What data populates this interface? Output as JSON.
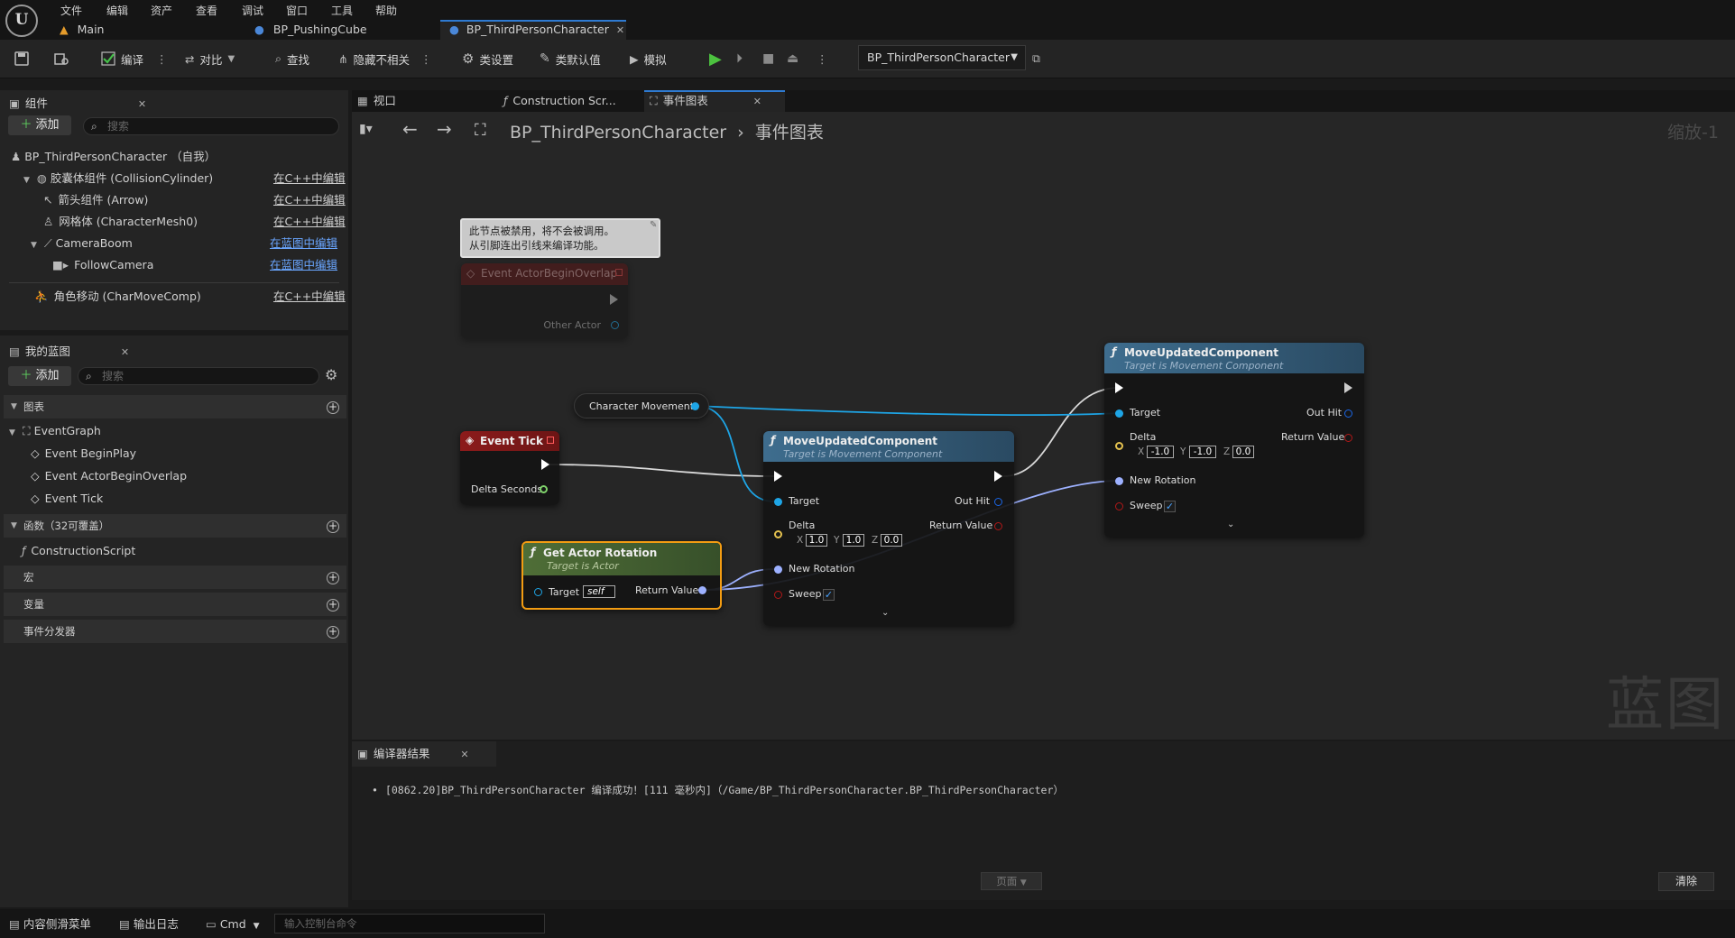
{
  "menu": {
    "items": [
      "文件",
      "编辑",
      "资产",
      "查看",
      "调试",
      "窗口",
      "工具",
      "帮助"
    ],
    "logo_text": "U"
  },
  "doc_tabs": [
    {
      "label": "Main",
      "icon": "level-icon"
    },
    {
      "label": "BP_PushingCube",
      "icon": "blueprint-icon"
    },
    {
      "label": "BP_ThirdPersonCharacter",
      "icon": "blueprint-icon",
      "active": true
    }
  ],
  "toolbar": {
    "compile": "编译",
    "diff": "对比",
    "find": "查找",
    "hide_unrelated": "隐藏不相关",
    "class_settings": "类设置",
    "class_defaults": "类默认值",
    "simulate": "模拟",
    "debug_object": "BP_ThirdPersonCharacter"
  },
  "components_panel": {
    "title": "组件",
    "add": "添加",
    "search_placeholder": "搜索",
    "root": "BP_ThirdPersonCharacter （自我）",
    "items": [
      {
        "label": "胶囊体组件 (CollisionCylinder)",
        "edit": "在C++中编辑",
        "indent": 1,
        "icon": "capsule-icon",
        "link_blue": false
      },
      {
        "label": "箭头组件 (Arrow)",
        "edit": "在C++中编辑",
        "indent": 2,
        "icon": "arrow-component-icon",
        "link_blue": false
      },
      {
        "label": "网格体 (CharacterMesh0)",
        "edit": "在C++中编辑",
        "indent": 2,
        "icon": "skeletal-mesh-icon",
        "link_blue": false
      },
      {
        "label": "CameraBoom",
        "edit": "在蓝图中编辑",
        "indent": 2,
        "icon": "spring-arm-icon",
        "link_blue": true
      },
      {
        "label": "FollowCamera",
        "edit": "在蓝图中编辑",
        "indent": 3,
        "icon": "camera-icon",
        "link_blue": true
      },
      {
        "label": "角色移动 (CharMoveComp)",
        "edit": "在C++中编辑",
        "indent": 1,
        "icon": "character-movement-icon",
        "link_blue": false
      }
    ]
  },
  "my_blueprint": {
    "title": "我的蓝图",
    "add": "添加",
    "search_placeholder": "搜索",
    "sections": {
      "graphs": "图表",
      "functions": "函数（32可覆盖）",
      "macros": "宏",
      "variables": "变量",
      "dispatchers": "事件分发器"
    },
    "event_graph": "EventGraph",
    "events": [
      "Event BeginPlay",
      "Event ActorBeginOverlap",
      "Event Tick"
    ],
    "construction_script": "ConstructionScript"
  },
  "graph_tabs": [
    {
      "label": "视口",
      "icon": "viewport-icon"
    },
    {
      "label": "Construction Scr...",
      "icon": "function-icon"
    },
    {
      "label": "事件图表",
      "icon": "event-graph-icon",
      "active": true
    }
  ],
  "breadcrumb": {
    "bp": "BP_ThirdPersonCharacter",
    "graph": "事件图表"
  },
  "zoom": "缩放-1",
  "watermark": "蓝图",
  "nodes": {
    "disabled_comment": "此节点被禁用，将不会被调用。\n从引脚连出引线来编译功能。",
    "begin_overlap": {
      "title": "Event ActorBeginOverlap",
      "pin": "Other Actor"
    },
    "event_tick": {
      "title": "Event Tick",
      "pin": "Delta Seconds"
    },
    "char_movement": "Character Movement",
    "get_actor_rotation": {
      "title": "Get Actor Rotation",
      "subtitle": "Target is Actor",
      "target": "Target",
      "target_value": "self",
      "output": "Return Value"
    },
    "move1": {
      "title": "MoveUpdatedComponent",
      "subtitle": "Target is Movement Component",
      "target": "Target",
      "delta": "Delta",
      "x": "1.0",
      "y": "1.0",
      "z": "0.0",
      "new_rotation": "New Rotation",
      "sweep": "Sweep",
      "out_hit": "Out Hit",
      "return_value": "Return Value"
    },
    "move2": {
      "title": "MoveUpdatedComponent",
      "subtitle": "Target is Movement Component",
      "target": "Target",
      "delta": "Delta",
      "x": "-1.0",
      "y": "-1.0",
      "z": "0.0",
      "new_rotation": "New Rotation",
      "sweep": "Sweep",
      "out_hit": "Out Hit",
      "return_value": "Return Value"
    },
    "axis_x": "X",
    "axis_y": "Y",
    "axis_z": "Z"
  },
  "compiler": {
    "title": "编译器结果",
    "log": "[0862.20]BP_ThirdPersonCharacter 编译成功！[111 毫秒内]（/Game/BP_ThirdPersonCharacter.BP_ThirdPersonCharacter）",
    "page": "页面",
    "clear": "清除"
  },
  "statusbar": {
    "content_drawer": "内容侧滑菜单",
    "output_log": "输出日志",
    "cmd": "Cmd",
    "console_placeholder": "输入控制台命令"
  },
  "colors": {
    "accent": "#2e7ad1",
    "event_header": "#8c1b1b",
    "function_header": "#3e6d8e",
    "pure_header": "#4f6e37",
    "object_pin": "#1ea5e6",
    "rotator_pin": "#9db1ff",
    "vector_pin": "#e5c24f",
    "hit_pin": "#1a66e6",
    "bool_pin": "#b01818"
  }
}
